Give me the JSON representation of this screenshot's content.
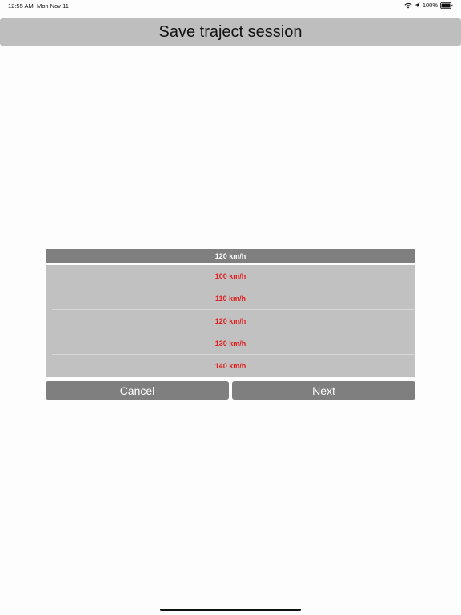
{
  "status_bar": {
    "time": "12:55 AM",
    "date": "Mon Nov 11",
    "battery_percent": "100%",
    "icons": [
      "wifi-icon",
      "location-icon",
      "battery-icon"
    ]
  },
  "header": {
    "title": "Save traject session"
  },
  "picker": {
    "selected_value": "120 km/h",
    "options": [
      {
        "label": "100 km/h"
      },
      {
        "label": "110 km/h"
      },
      {
        "label": "120 km/h"
      },
      {
        "label": "130 km/h"
      },
      {
        "label": "140 km/h"
      }
    ],
    "option_color": "#e11d1d"
  },
  "actions": {
    "cancel_label": "Cancel",
    "next_label": "Next"
  },
  "colors": {
    "header_bg": "#bebebe",
    "button_bg": "#7f7f7f",
    "list_bg": "#c1c1c1"
  }
}
